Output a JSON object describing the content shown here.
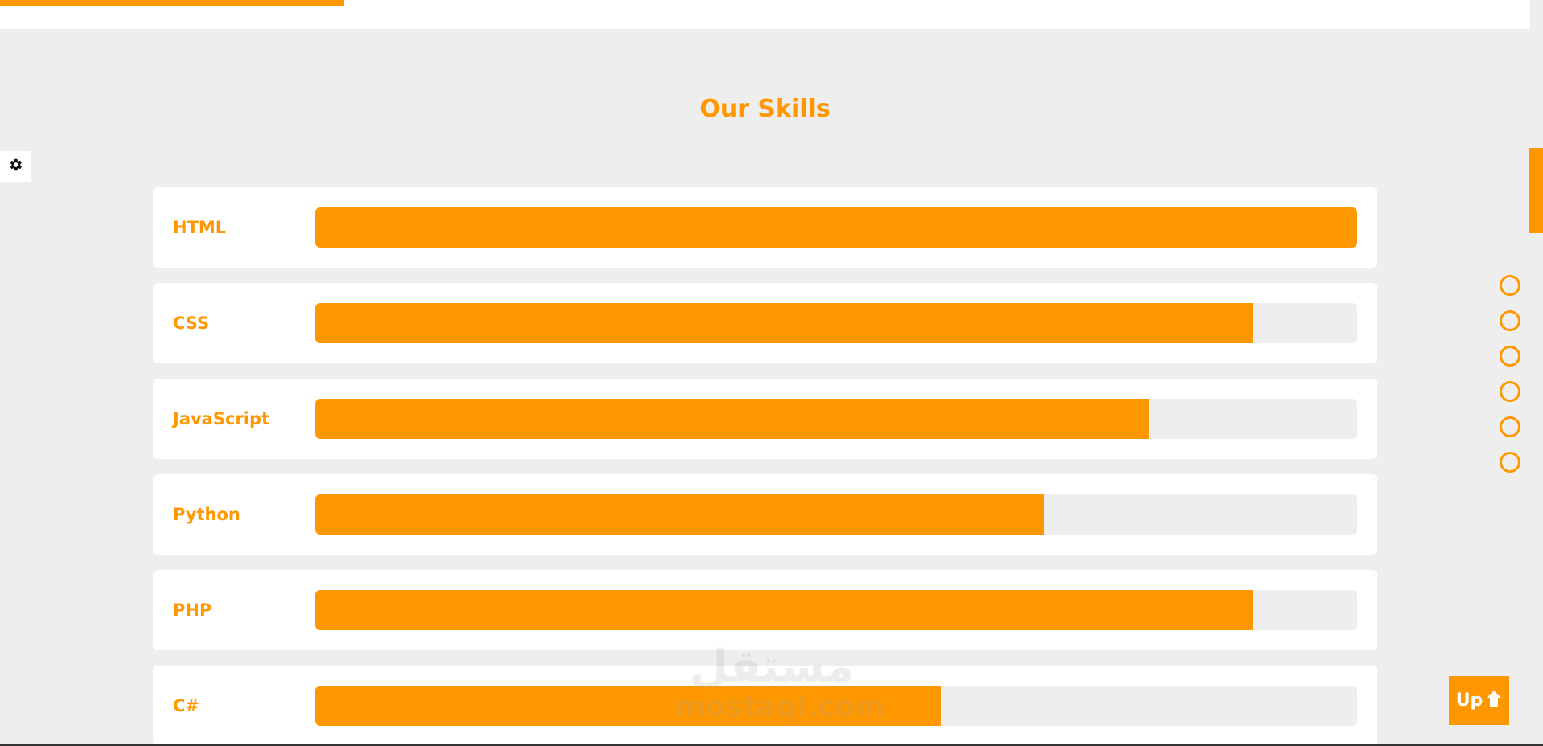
{
  "section": {
    "title": "Our Skills"
  },
  "skills": [
    {
      "name": "HTML",
      "level": 1.0
    },
    {
      "name": "CSS",
      "level": 0.9
    },
    {
      "name": "JavaScript",
      "level": 0.8
    },
    {
      "name": "Python",
      "level": 0.7
    },
    {
      "name": "PHP",
      "level": 0.9
    },
    {
      "name": "C#",
      "level": 0.6
    }
  ],
  "nav": {
    "bullet_count": 6
  },
  "up_button": {
    "label": "Up",
    "icon": "arrow-up-icon"
  },
  "settings": {
    "icon": "gear-icon"
  },
  "watermark": {
    "arabic": "مستقل",
    "latin": "mostaql.com"
  },
  "colors": {
    "accent": "#ff9800",
    "background": "#eeeeee",
    "card": "#ffffff"
  }
}
